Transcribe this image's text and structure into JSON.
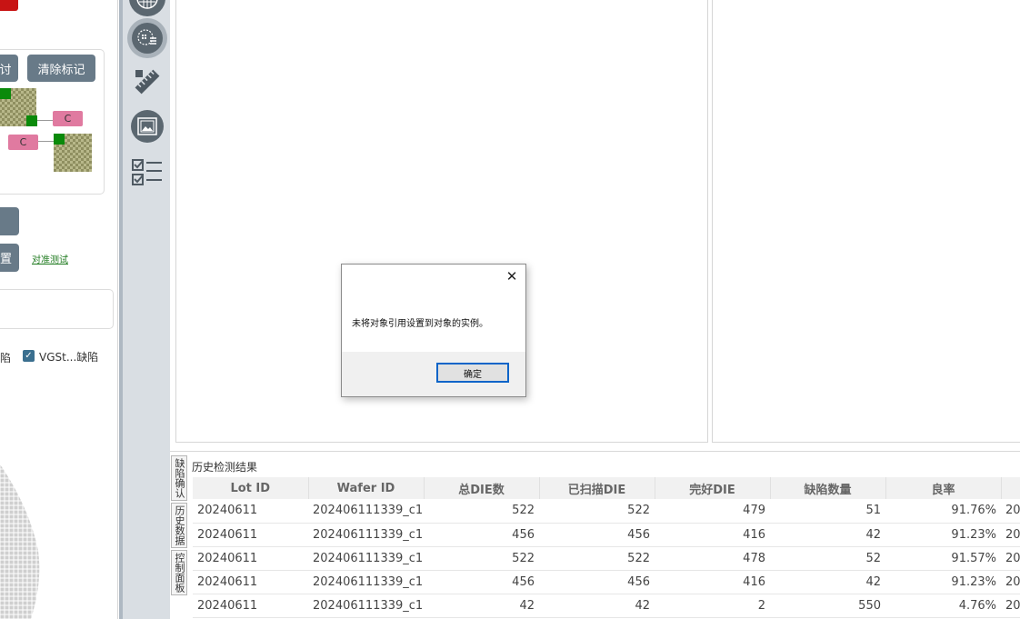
{
  "left_panel": {
    "clip_button_label": "讨",
    "clear_marks_button_label": "清除标记",
    "tag_c_1": "C",
    "tag_c_2": "C",
    "clip_button_2_label": "置",
    "alignment_test_link": "对准测试",
    "defect_checkbox_partial_label": "陷",
    "vgst_checkbox_label": "VGSt...缺陷"
  },
  "toolbar": {
    "icons": [
      "wafer-map-icon",
      "wafer-list-icon",
      "ruler-icon",
      "image-icon",
      "checklist-icon"
    ]
  },
  "bottom_panel": {
    "vertical_tabs": [
      "缺陷确认",
      "历史数据",
      "控制面板"
    ],
    "title": "历史检测结果",
    "columns": [
      "Lot ID",
      "Wafer ID",
      "总DIE数",
      "已扫描DIE",
      "完好DIE",
      "缺陷数量",
      "良率",
      ""
    ],
    "rows": [
      [
        "20240611",
        "202406111339_c1",
        "522",
        "522",
        "479",
        "51",
        "91.76%",
        "20"
      ],
      [
        "20240611",
        "202406111339_c1",
        "456",
        "456",
        "416",
        "42",
        "91.23%",
        "20"
      ],
      [
        "20240611",
        "202406111339_c1",
        "522",
        "522",
        "478",
        "52",
        "91.57%",
        "20"
      ],
      [
        "20240611",
        "202406111339_c1",
        "456",
        "456",
        "416",
        "42",
        "91.23%",
        "20"
      ],
      [
        "20240611",
        "202406111339_c1",
        "42",
        "42",
        "2",
        "550",
        "4.76%",
        "20"
      ]
    ]
  },
  "dialog": {
    "message": "未将对象引用设置到对象的实例。",
    "ok_label": "确定",
    "close_glyph": "✕"
  }
}
